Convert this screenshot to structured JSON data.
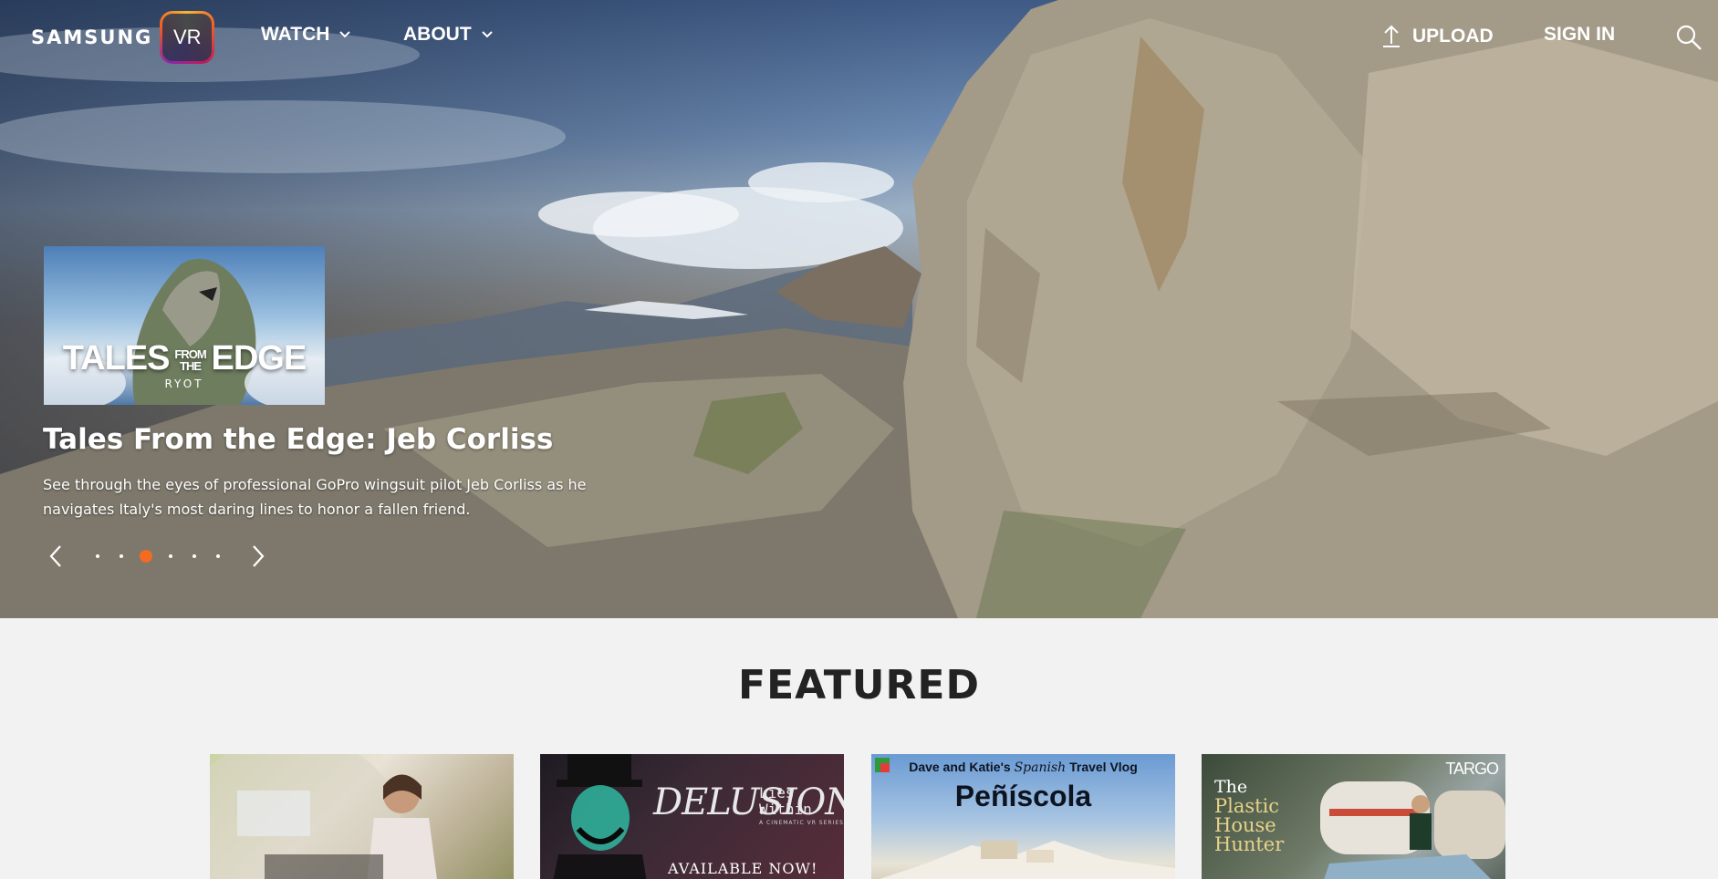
{
  "nav": {
    "brand": "SAMSUNG",
    "badge": "VR",
    "watch_label": "WATCH",
    "about_label": "ABOUT",
    "upload_label": "UPLOAD",
    "signin_label": "SIGN IN"
  },
  "hero": {
    "thumb_title_left": "TALES",
    "thumb_title_mid": "FROM THE",
    "thumb_title_right": "EDGE",
    "thumb_sub": "RYOT",
    "title": "Tales From the Edge: Jeb Corliss",
    "description": "See through the eyes of professional GoPro wingsuit pilot Jeb Corliss as he navigates Italy's most daring lines to honor a fallen friend.",
    "slide_count": 6,
    "active_slide": 3,
    "accent_color": "#f26b21"
  },
  "featured": {
    "title": "FEATURED",
    "cards": [
      {},
      {
        "title": "DELUSION",
        "subtitle": "Lies Within",
        "series": "A CINEMATIC VR SERIES",
        "cta": "AVAILABLE NOW!"
      },
      {
        "top_line_a": "Dave and Katie's",
        "top_line_italic": "Spanish",
        "top_line_b": "Travel Vlog",
        "title": "Peñíscola"
      },
      {
        "brand": "TARGO",
        "title_line1": "The",
        "title_line2": "Plastic",
        "title_line3": "House",
        "title_line4": "Hunter"
      }
    ]
  },
  "icons": [
    "chevron-down-icon",
    "upload-icon",
    "search-icon",
    "chevron-left-icon",
    "chevron-right-icon"
  ]
}
